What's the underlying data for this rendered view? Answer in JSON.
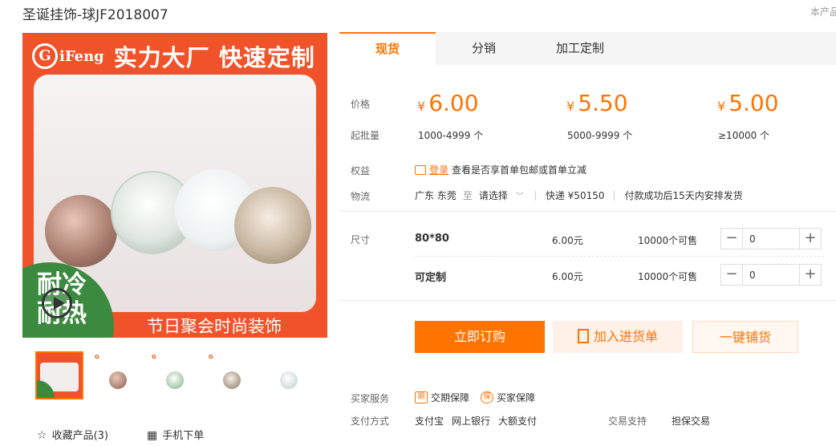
{
  "product": {
    "title": "圣诞挂饰-球JF2018007",
    "corner_note": "本产品"
  },
  "gallery": {
    "logo": {
      "mark": "G",
      "text": "iFeng"
    },
    "banner_text": "实力大厂 快速定制",
    "badge_lines": [
      "耐冷",
      "耐热"
    ],
    "bottom_caption": "节日聚会时尚装饰",
    "thumbnails": [
      {
        "active": true
      },
      {
        "active": false
      },
      {
        "active": false
      },
      {
        "active": false
      },
      {
        "active": false
      }
    ]
  },
  "actions_left": {
    "favorite": "收藏产品(3)",
    "mobile_order": "手机下单"
  },
  "tabs": [
    "现货",
    "分销",
    "加工定制"
  ],
  "labels": {
    "price": "价格",
    "min_batch": "起批量",
    "rights": "权益",
    "logistics": "物流",
    "size": "尺寸",
    "buyer_service": "买家服务",
    "payment": "支付方式",
    "trade_support": "交易支持"
  },
  "price_tiers": [
    {
      "currency": "¥",
      "price": "6.00",
      "range": "1000-4999 个"
    },
    {
      "currency": "¥",
      "price": "5.50",
      "range": "5000-9999 个"
    },
    {
      "currency": "¥",
      "price": "5.00",
      "range": "≥10000 个"
    }
  ],
  "rights": {
    "login": "登录",
    "text": "查看是否享首单包邮或首单立减"
  },
  "logistics": {
    "from": "广东 东莞",
    "to_word": "至",
    "select": "请选择",
    "express": "快递 ¥50150",
    "delivery": "付款成功后15天内安排发货"
  },
  "skus": [
    {
      "name": "80*80",
      "price": "6.00元",
      "stock": "10000个可售",
      "qty": "0"
    },
    {
      "name": "可定制",
      "price": "6.00元",
      "stock": "10000个可售",
      "qty": "0"
    }
  ],
  "buttons": {
    "order": "立即订购",
    "cart": "加入进货单",
    "distribute": "一键铺货"
  },
  "services": [
    {
      "icon": "期",
      "label": "交期保障"
    },
    {
      "icon": "保",
      "label": "买家保障"
    }
  ],
  "payment_methods": [
    "支付宝",
    "网上银行",
    "大额支付"
  ],
  "trade_support": "担保交易",
  "colors": {
    "accent": "#ff7300",
    "banner": "#f0532a",
    "badge_green": "#3b8a3f"
  }
}
